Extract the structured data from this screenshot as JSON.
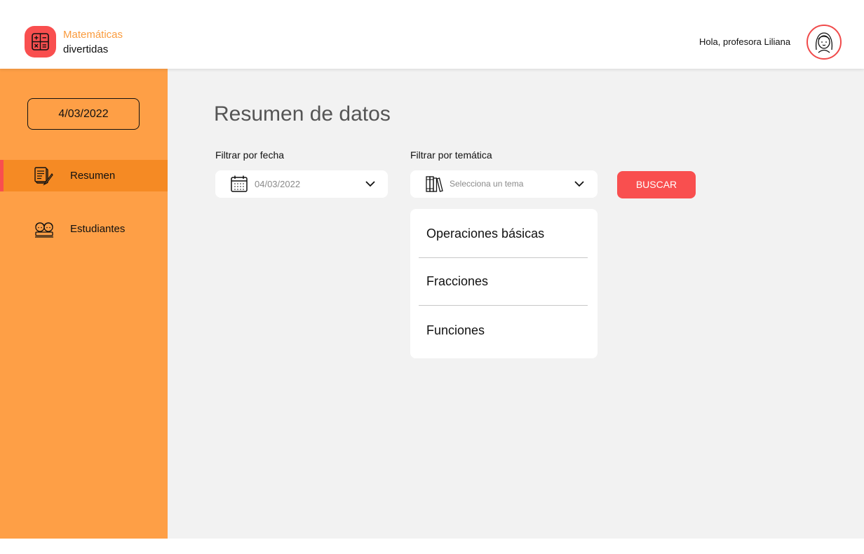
{
  "header": {
    "brand_line1": "Matemáticas",
    "brand_line2": "divertidas",
    "greeting": "Hola, profesora Liliana",
    "logo_icon": "calculator-icon",
    "avatar_icon": "teacher-avatar-icon"
  },
  "sidebar": {
    "date": "4/03/2022",
    "items": [
      {
        "label": "Resumen",
        "icon": "notes-pencil-icon",
        "active": true
      },
      {
        "label": "Estudiantes",
        "icon": "students-icon",
        "active": false
      }
    ]
  },
  "main": {
    "title": "Resumen de datos",
    "date_filter": {
      "label": "Filtrar por fecha",
      "value": "04/03/2022",
      "icon": "calendar-icon"
    },
    "topic_filter": {
      "label": "Filtrar por temática",
      "placeholder": "Selecciona un tema",
      "icon": "books-icon",
      "options": [
        "Operaciones básicas",
        "Fracciones",
        "Funciones"
      ]
    },
    "search_button": "BUSCAR"
  },
  "colors": {
    "brand_orange": "#fe9f46",
    "active_orange": "#f58a24",
    "accent_red": "#f94f4f",
    "content_bg": "#f2f2f2"
  }
}
